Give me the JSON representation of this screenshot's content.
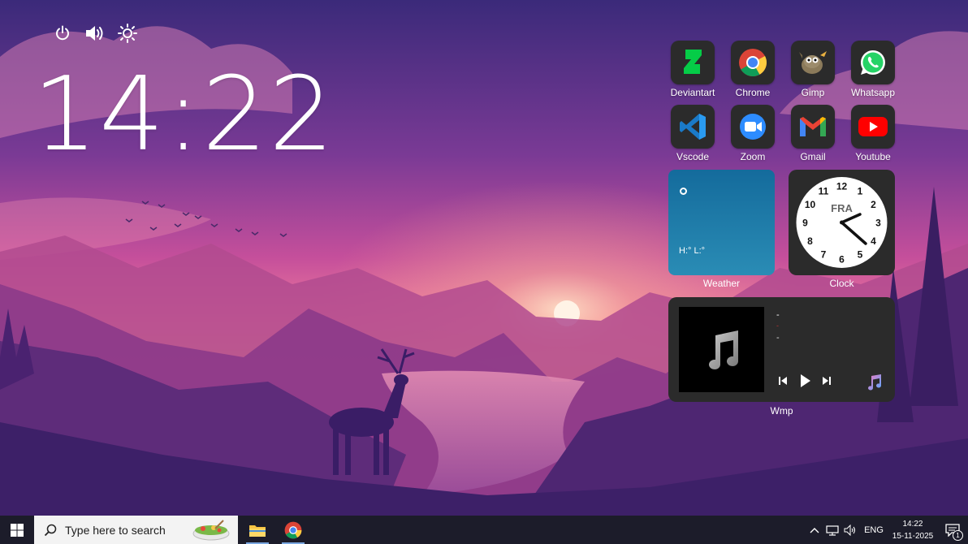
{
  "desktop": {
    "time_big": "14:22",
    "quick_controls": [
      {
        "name": "power-icon"
      },
      {
        "name": "volume-icon"
      },
      {
        "name": "brightness-icon"
      }
    ]
  },
  "apps": [
    {
      "label": "Deviantart",
      "icon": "deviantart-icon"
    },
    {
      "label": "Chrome",
      "icon": "chrome-icon"
    },
    {
      "label": "Gimp",
      "icon": "gimp-icon"
    },
    {
      "label": "Whatsapp",
      "icon": "whatsapp-icon"
    },
    {
      "label": "Vscode",
      "icon": "vscode-icon"
    },
    {
      "label": "Zoom",
      "icon": "zoom-icon"
    },
    {
      "label": "Gmail",
      "icon": "gmail-icon"
    },
    {
      "label": "Youtube",
      "icon": "youtube-icon"
    }
  ],
  "weather": {
    "label": "Weather",
    "hi_lo": "H:° L:°"
  },
  "clock_widget": {
    "label": "Clock",
    "city": "FRA",
    "numbers": [
      "12",
      "1",
      "2",
      "3",
      "4",
      "5",
      "6",
      "7",
      "8",
      "9",
      "10",
      "11"
    ]
  },
  "player": {
    "label": "Wmp",
    "title": "-",
    "artist": "-",
    "album": "-"
  },
  "taskbar": {
    "search_placeholder": "Type here to search",
    "language": "ENG",
    "time": "14:22",
    "date": "15-11-2025",
    "notification_count": "1"
  },
  "colors": {
    "sky_top": "#3a2a7a",
    "sky_mid": "#c04f9a",
    "horizon": "#f7a089",
    "taskbar": "#1c1c2a",
    "tile": "#2b2b2b"
  }
}
